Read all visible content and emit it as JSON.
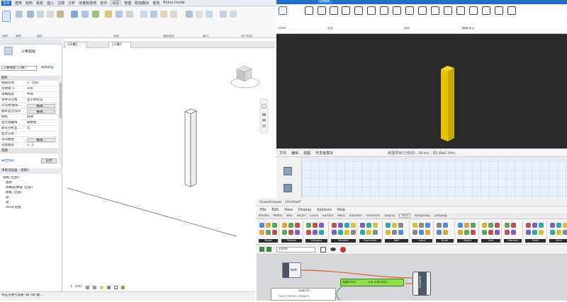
{
  "revit": {
    "menu": [
      "文件",
      "建筑",
      "结构",
      "系统",
      "插入",
      "注释",
      "分析",
      "体量和场地",
      "协作",
      "视图",
      "管理",
      "附加模块",
      "修改",
      "Rhino.Inside",
      "修改"
    ],
    "menu_active_index": 9,
    "ribbon_groups": [
      "选择",
      "属性",
      "图形",
      "创建",
      "图纸组合",
      "窗口",
      "用户界面"
    ],
    "properties": {
      "type_name": "三维视图",
      "type_selector_label": "三维视图 (三维)",
      "edit_type": "编辑类型",
      "section_graphics": "图形",
      "rows": [
        {
          "k": "视图比例",
          "v": "1 : 100"
        },
        {
          "k": "比例值 1:",
          "v": "100"
        },
        {
          "k": "详细程度",
          "v": "中等"
        },
        {
          "k": "零件可见性",
          "v": "显示原状态"
        },
        {
          "k": "可见性/图形...",
          "v": "编辑...",
          "btn": true
        },
        {
          "k": "图形显示选项",
          "v": "编辑...",
          "btn": true
        },
        {
          "k": "规程",
          "v": "协调"
        },
        {
          "k": "显示隐藏线",
          "v": "按规程"
        },
        {
          "k": "默认分析显...",
          "v": "无"
        },
        {
          "k": "显示在各...",
          "v": ""
        },
        {
          "k": "日光路径",
          "v": "编辑...",
          "btn": true
        },
        {
          "k": "范围裁剪",
          "v": "1 : 1"
        }
      ],
      "section_extents": "范围",
      "help_link": "属性帮助",
      "apply": "应用"
    },
    "browser": {
      "title": "项目浏览器 - 项目1",
      "items": [
        "视图 (全部)",
        "图例",
        "明细表/数量 (全部)",
        "图纸 (全部)",
        "族",
        "组",
        "Revit 链接"
      ]
    },
    "tabs": [
      "{三维}",
      "{三维}"
    ],
    "view_scale": "1 : 100",
    "status_text": "单击可进行选择; 按 Tab 键..."
  },
  "rhino": {
    "tab_label": "GAMA",
    "panel_labels": [
      "GAMA",
      "标准",
      "曲线",
      "编辑/变动"
    ],
    "menu": [
      "文件",
      "编辑",
      "视图",
      "开发者模块"
    ],
    "doc_title": "新建项目(已修改) - Rhino - 3D-Wall.3dm"
  },
  "grasshopper": {
    "title": "Grasshopper - Untitled*",
    "menu": [
      "File",
      "Edit",
      "View",
      "Display",
      "Solution",
      "Help"
    ],
    "tabs": [
      "Params",
      "Maths",
      "Sets",
      "Vector",
      "Curve",
      "Surface",
      "Mesh",
      "Intersect",
      "Transform",
      "Display",
      "Revit",
      "Kangaroo2",
      "Ladybug"
    ],
    "active_tab_index": 10,
    "panels": [
      "Model",
      "Params",
      "Category",
      "Element",
      "Document",
      "Wall",
      "Input",
      "Build",
      "Object",
      "Add",
      "Intersect",
      "Revit",
      "Elem"
    ],
    "zoom": "100%",
    "slider_label": "宽度(mm)",
    "slider_value": "3 ♦ 200(mm)",
    "param_label": "构件",
    "component_label": "Column",
    "search_label": "Search...",
    "search_sub": "Revit Family Category"
  },
  "colors": {
    "revit_blue": "#1e6ec8",
    "rhino_bg": "#2a2a2a",
    "column_yellow": "#e8c400",
    "gh_wire": "#e06020",
    "slider_green": "#8ee04a"
  }
}
